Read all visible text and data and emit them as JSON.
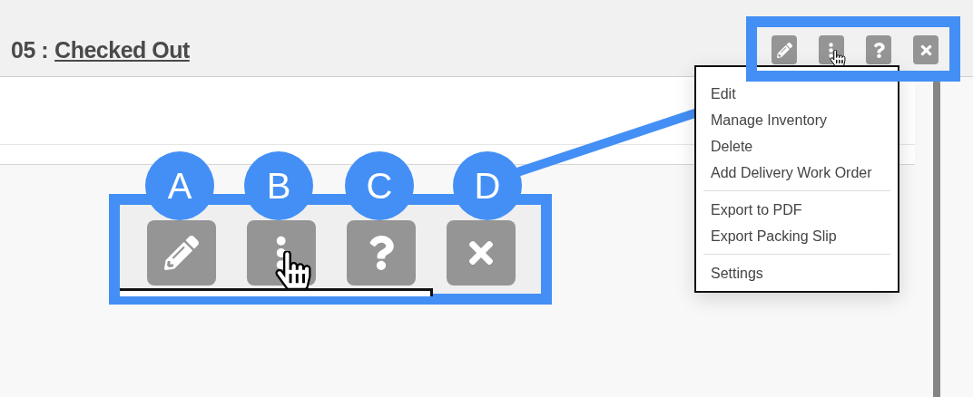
{
  "header": {
    "number": "05 :",
    "status": "Checked Out"
  },
  "toolbar": [
    {
      "kind": "edit",
      "hovered": false
    },
    {
      "kind": "more",
      "hovered": true
    },
    {
      "kind": "help",
      "hovered": false
    },
    {
      "kind": "close",
      "hovered": false
    }
  ],
  "menu": {
    "groups": [
      [
        "Edit",
        "Manage Inventory",
        "Delete",
        "Add Delivery Work Order"
      ],
      [
        "Export to PDF",
        "Export Packing Slip"
      ],
      [
        "Settings"
      ]
    ]
  },
  "callouts": [
    {
      "label": "A",
      "kind": "edit",
      "hovered": false
    },
    {
      "label": "B",
      "kind": "more",
      "hovered": true
    },
    {
      "label": "C",
      "kind": "help",
      "hovered": false
    },
    {
      "label": "D",
      "kind": "close",
      "hovered": false
    }
  ]
}
